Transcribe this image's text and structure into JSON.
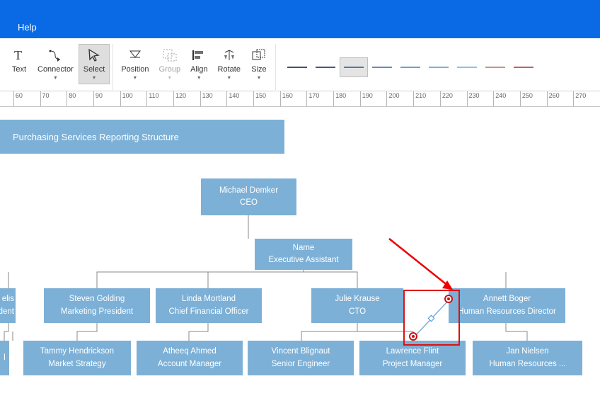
{
  "menu": {
    "help": "Help"
  },
  "ribbon": {
    "text": "Text",
    "connector": "Connector",
    "select": "Select",
    "position": "Position",
    "group": "Group",
    "align": "Align",
    "rotate": "Rotate",
    "size": "Size"
  },
  "line_colors": [
    "#2f3a56",
    "#27427a",
    "#3d6aa3",
    "#4d7eb3",
    "#5d92c3",
    "#6da5d3",
    "#7eb8e3",
    "#c47f7f",
    "#b84c4c"
  ],
  "selected_line_index": 2,
  "ruler_start": 60,
  "ruler_end": 275,
  "ruler_step": 10,
  "diagram": {
    "title": "Purchasing Services Reporting Structure",
    "ceo": {
      "name": "Michael Demker",
      "role": "CEO"
    },
    "ea": {
      "name": "Name",
      "role": "Executive Assistant"
    },
    "row2": [
      {
        "name_partial": "elis",
        "role_partial": "dent"
      },
      {
        "name": "Steven Golding",
        "role": "Marketing President"
      },
      {
        "name": "Linda Mortland",
        "role": "Chief Financial Officer"
      },
      {
        "name": "Julie Krause",
        "role": "CTO"
      },
      {
        "name": "Annett Boger",
        "role": "Human Resources Director"
      }
    ],
    "row3_left_partial": "I",
    "row3": [
      {
        "name": "Tammy Hendrickson",
        "role": "Market Strategy"
      },
      {
        "name": "Atheeq Ahmed",
        "role": "Account Manager"
      },
      {
        "name": "Vincent Blignaut",
        "role": "Senior Engineer"
      },
      {
        "name": "Lawrence Flint",
        "role": "Project Manager"
      },
      {
        "name": "Jan Nielsen",
        "role": "Human Resources ..."
      }
    ]
  }
}
